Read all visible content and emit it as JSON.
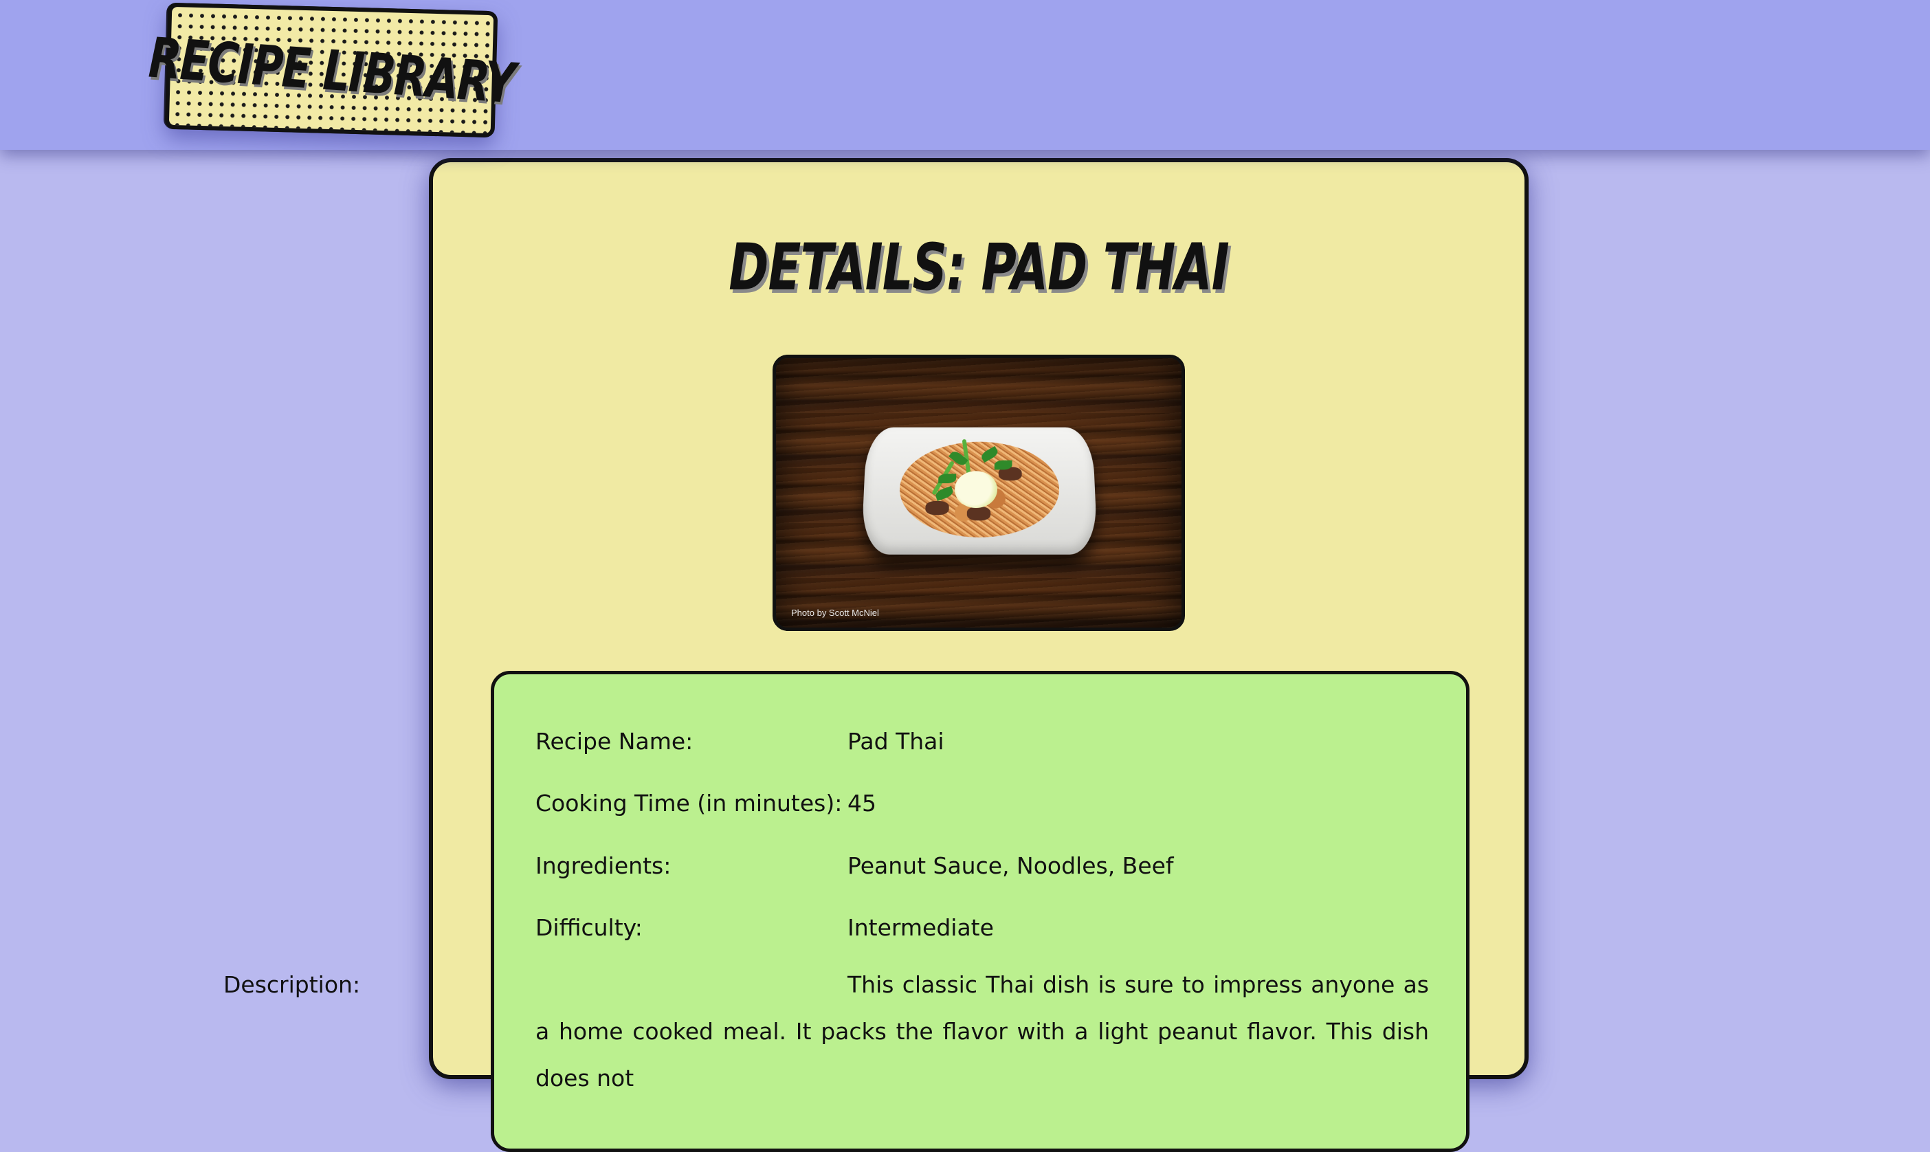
{
  "header": {
    "logo_text": "RECIPE LIBRARY"
  },
  "page": {
    "title": "DETAILS: PAD THAI"
  },
  "photo": {
    "credit": "Photo by Scott McNiel",
    "alt": "Pad Thai"
  },
  "details": {
    "rows": [
      {
        "label": "Recipe Name:",
        "value": "Pad Thai"
      },
      {
        "label": "Cooking Time (in minutes):",
        "value": "45"
      },
      {
        "label": "Ingredients:",
        "value": "Peanut Sauce, Noodles, Beef"
      },
      {
        "label": "Difficulty:",
        "value": "Intermediate"
      }
    ],
    "description": {
      "label": "Description:",
      "value": "This classic Thai dish is sure to impress anyone as a home cooked meal. It packs the flavor with a light peanut flavor. This dish does not"
    }
  },
  "colors": {
    "header_bg": "#9fa3ee",
    "page_bg": "#b9b9ef",
    "card_bg": "#f0eaa3",
    "details_bg": "#bbf08f",
    "text": "#111111"
  }
}
